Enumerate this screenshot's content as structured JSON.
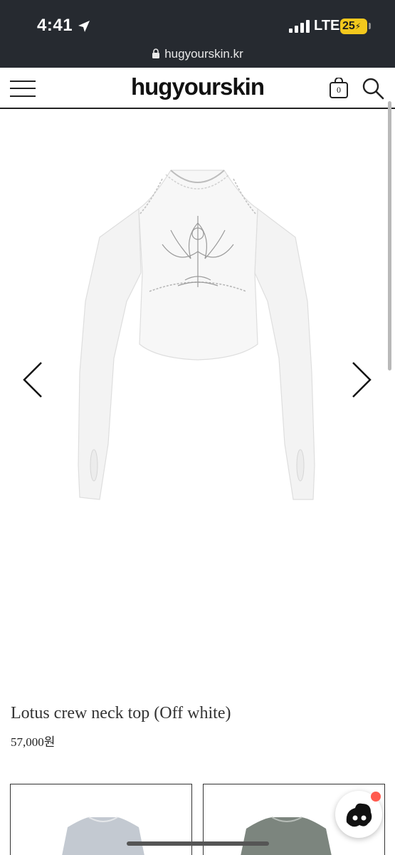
{
  "status_bar": {
    "time": "4:41",
    "network": "LTE",
    "battery": "25"
  },
  "browser": {
    "url": "hugyourskin.kr"
  },
  "header": {
    "logo": "hugyourskin",
    "cart_count": "0",
    "icons": [
      "menu-icon",
      "cart-icon",
      "search-icon"
    ]
  },
  "product": {
    "title": "Lotus crew neck top (Off white)",
    "price": "57,000원"
  },
  "colors": {
    "chrome": "#262a30",
    "battery": "#f2c81d",
    "badge": "#ff5a4e"
  }
}
